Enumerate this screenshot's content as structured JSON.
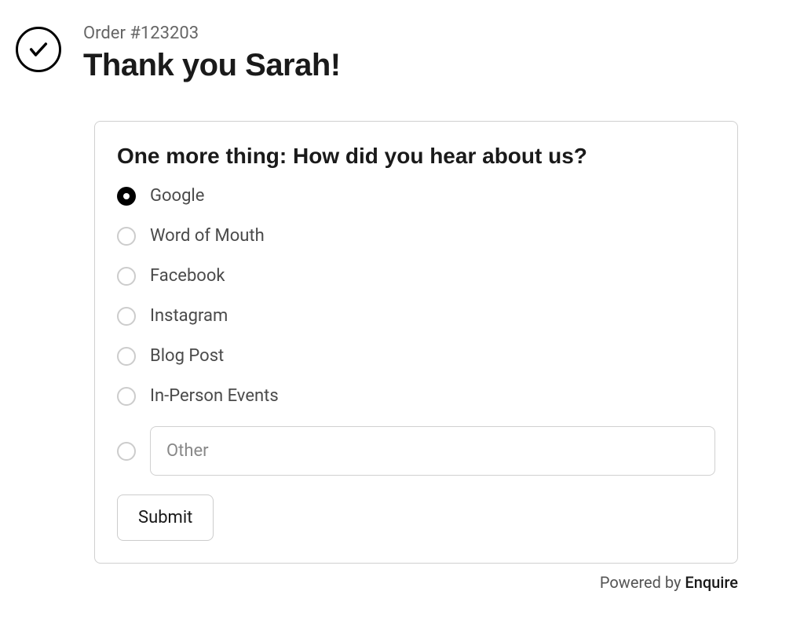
{
  "header": {
    "order_number": "Order #123203",
    "thank_you": "Thank you Sarah!"
  },
  "survey": {
    "question": "One more thing: How did you hear about us?",
    "options": [
      {
        "label": "Google",
        "selected": true
      },
      {
        "label": "Word of Mouth",
        "selected": false
      },
      {
        "label": "Facebook",
        "selected": false
      },
      {
        "label": "Instagram",
        "selected": false
      },
      {
        "label": "Blog Post",
        "selected": false
      },
      {
        "label": "In-Person Events",
        "selected": false
      }
    ],
    "other_placeholder": "Other",
    "submit_label": "Submit"
  },
  "footer": {
    "powered_by_prefix": "Powered by ",
    "powered_by_brand": "Enquire"
  }
}
